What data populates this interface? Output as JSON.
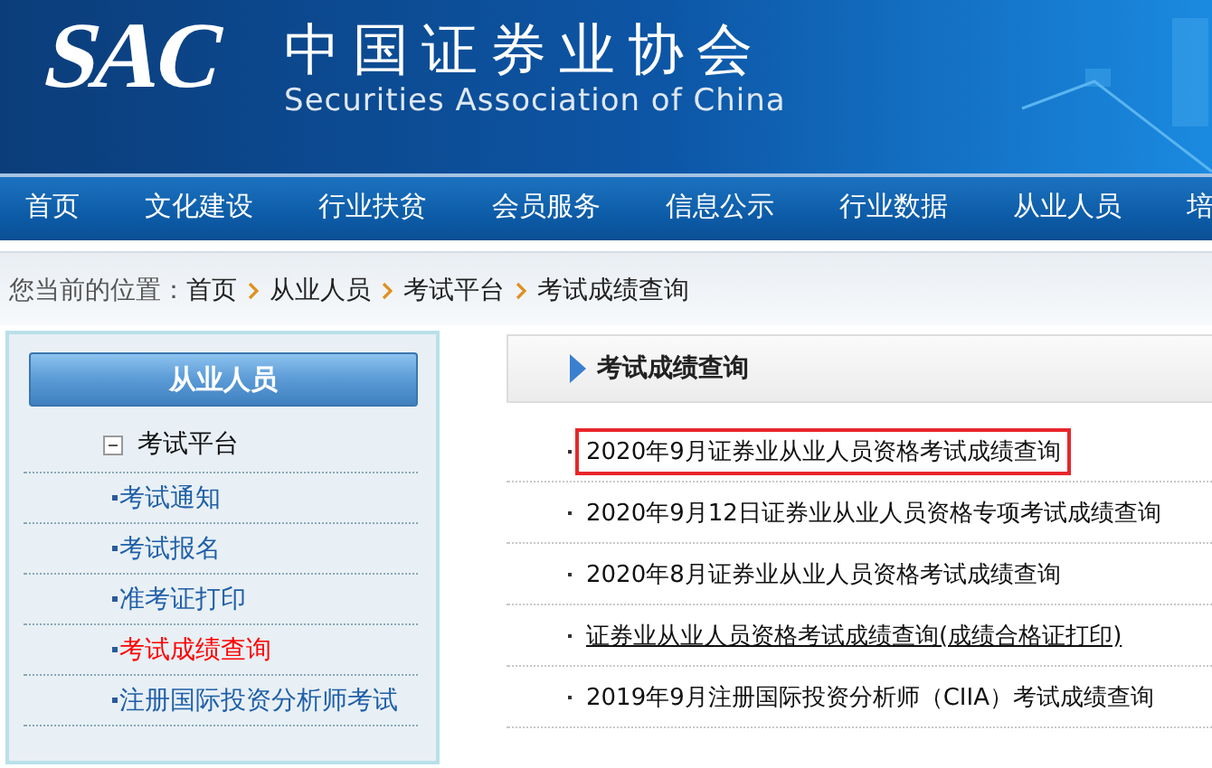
{
  "header": {
    "logo": "SAC",
    "title": "中国证券业协会",
    "subtitle": "Securities Association of China"
  },
  "nav": [
    "首页",
    "文化建设",
    "行业扶贫",
    "会员服务",
    "信息公示",
    "行业数据",
    "从业人员",
    "培"
  ],
  "breadcrumb": {
    "label": "您当前的位置：",
    "items": [
      "首页",
      "从业人员",
      "考试平台",
      "考试成绩查询"
    ]
  },
  "sidebar": {
    "title": "从业人员",
    "group": {
      "label": "考试平台",
      "expanded": true,
      "children": [
        {
          "label": "考试通知",
          "selected": false
        },
        {
          "label": "考试报名",
          "selected": false
        },
        {
          "label": "准考证打印",
          "selected": false
        },
        {
          "label": "考试成绩查询",
          "selected": true
        },
        {
          "label": "注册国际投资分析师考试",
          "selected": false
        }
      ]
    }
  },
  "content": {
    "title": "考试成绩查询",
    "items": [
      {
        "text": "2020年9月证券业从业人员资格考试成绩查询",
        "highlighted": true,
        "underlined": false
      },
      {
        "text": "2020年9月12日证券业从业人员资格专项考试成绩查询",
        "highlighted": false,
        "underlined": false
      },
      {
        "text": "2020年8月证券业从业人员资格考试成绩查询",
        "highlighted": false,
        "underlined": false
      },
      {
        "text": "证券业从业人员资格考试成绩查询(成绩合格证打印)",
        "highlighted": false,
        "underlined": true
      },
      {
        "text": "2019年9月注册国际投资分析师（CIIA）考试成绩查询",
        "highlighted": false,
        "underlined": false
      }
    ]
  }
}
